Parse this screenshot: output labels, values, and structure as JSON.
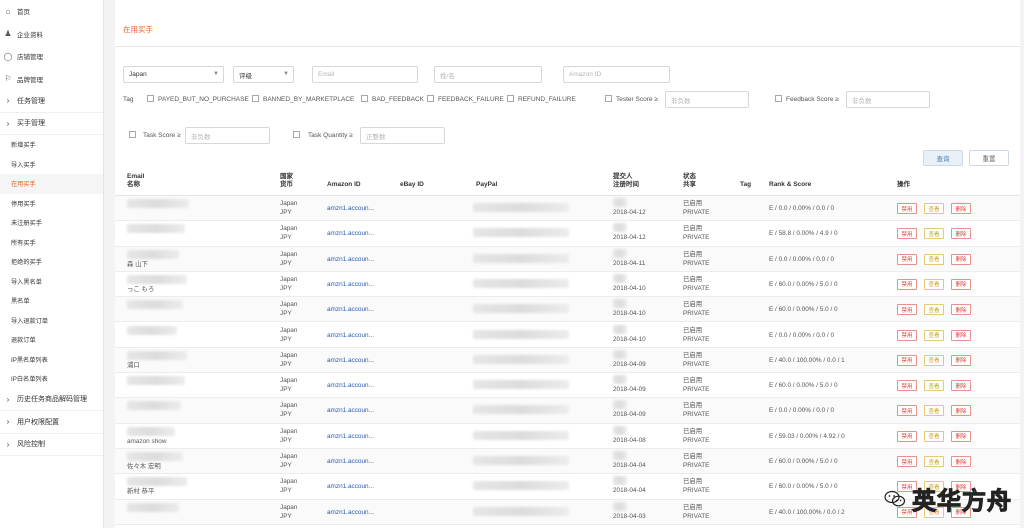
{
  "sidebar": {
    "top_items": [
      {
        "icon": "home-icon",
        "glyph": "⌂",
        "label": "首页"
      },
      {
        "icon": "company-icon",
        "glyph": "♟",
        "label": "企业资料"
      },
      {
        "icon": "shop-icon",
        "glyph": "◯",
        "label": "店铺管理"
      },
      {
        "icon": "bookmark-icon",
        "glyph": "⚐",
        "label": "品牌管理"
      }
    ],
    "groups_before": [
      {
        "label": "任务管理"
      },
      {
        "label": "买手管理"
      }
    ],
    "sub_items": [
      {
        "label": "新增买手",
        "active": false
      },
      {
        "label": "导入买手",
        "active": false
      },
      {
        "label": "在用买手",
        "active": true
      },
      {
        "label": "停用买手",
        "active": false
      },
      {
        "label": "未注册买手",
        "active": false
      },
      {
        "label": "所有买手",
        "active": false
      },
      {
        "label": "拒绝的买手",
        "active": false
      },
      {
        "label": "导入黑名单",
        "active": false
      },
      {
        "label": "黑名单",
        "active": false
      },
      {
        "label": "导入退款订单",
        "active": false
      },
      {
        "label": "退款订单",
        "active": false
      },
      {
        "label": "IP黑名单列表",
        "active": false
      },
      {
        "label": "IP白名单列表",
        "active": false
      }
    ],
    "groups_after": [
      {
        "label": "历史任务商品解码管理"
      },
      {
        "label": "用户权限配置"
      },
      {
        "label": "风险控制"
      }
    ]
  },
  "page": {
    "title": "在用买手"
  },
  "filters": {
    "country": "Japan",
    "rating": "评级",
    "email_placeholder": "Email",
    "name_placeholder": "姓/名",
    "amazon_id_placeholder": "Amazon ID",
    "tag_label": "Tag",
    "tags": [
      "PAYED_BUT_NO_PURCHASE",
      "BANNED_BY_MARKETPLACE",
      "BAD_FEEDBACK",
      "FEEDBACK_FAILURE",
      "REFUND_FAILURE"
    ],
    "tester_score_label": "Tester Score ≥",
    "tester_score_placeholder": "非负数",
    "feedback_score_label": "Feedback Score ≥",
    "feedback_score_placeholder": "非负数",
    "task_score_label": "Task Score ≥",
    "task_score_placeholder": "非负数",
    "task_quantity_label": "Task Quantity ≥",
    "task_quantity_placeholder": "正整数",
    "search_label": "查询",
    "reset_label": "重置"
  },
  "table": {
    "headers": {
      "email": "Email",
      "name": "名称",
      "country": "国家",
      "currency": "货币",
      "amazon_id": "Amazon ID",
      "ebay_id": "eBay ID",
      "paypal": "PayPal",
      "submitter": "提交人",
      "reg_time": "注册时间",
      "status": "状态",
      "share": "共享",
      "tag": "Tag",
      "rank_score": "Rank & Score",
      "actions": "操作"
    },
    "action_labels": {
      "ban": "禁用",
      "view": "查看",
      "delete": "删除"
    },
    "rows": [
      {
        "name": "",
        "country": "Japan",
        "currency": "JPY",
        "amazon": "amzn1.accoun...",
        "date": "2018-04-12",
        "status": "已启用",
        "share": "PRIVATE",
        "rank": "E / 0.0 / 0.00% / 0.0 / 0"
      },
      {
        "name": "",
        "country": "Japan",
        "currency": "JPY",
        "amazon": "amzn1.accoun...",
        "date": "2018-04-12",
        "status": "已启用",
        "share": "PRIVATE",
        "rank": "E / 58.8 / 0.00% / 4.9 / 0"
      },
      {
        "name": "森 山下",
        "country": "Japan",
        "currency": "JPY",
        "amazon": "amzn1.accoun...",
        "date": "2018-04-11",
        "status": "已启用",
        "share": "PRIVATE",
        "rank": "E / 0.0 / 0.00% / 0.0 / 0"
      },
      {
        "name": "っこ もろ",
        "country": "Japan",
        "currency": "JPY",
        "amazon": "amzn1.accoun...",
        "date": "2018-04-10",
        "status": "已启用",
        "share": "PRIVATE",
        "rank": "E / 60.0 / 0.00% / 5.0 / 0"
      },
      {
        "name": "",
        "country": "Japan",
        "currency": "JPY",
        "amazon": "amzn1.accoun...",
        "date": "2018-04-10",
        "status": "已启用",
        "share": "PRIVATE",
        "rank": "E / 60.0 / 0.00% / 5.0 / 0"
      },
      {
        "name": "",
        "country": "Japan",
        "currency": "JPY",
        "amazon": "amzn1.accoun...",
        "date": "2018-04-10",
        "status": "已启用",
        "share": "PRIVATE",
        "rank": "E / 0.0 / 0.00% / 0.0 / 0"
      },
      {
        "name": "浦口",
        "country": "Japan",
        "currency": "JPY",
        "amazon": "amzn1.accoun...",
        "date": "2018-04-09",
        "status": "已启用",
        "share": "PRIVATE",
        "rank": "E / 40.0 / 100.00% / 0.0 / 1"
      },
      {
        "name": "",
        "country": "Japan",
        "currency": "JPY",
        "amazon": "amzn1.accoun...",
        "date": "2018-04-09",
        "status": "已启用",
        "share": "PRIVATE",
        "rank": "E / 60.0 / 0.00% / 5.0 / 0"
      },
      {
        "name": "",
        "country": "Japan",
        "currency": "JPY",
        "amazon": "amzn1.accoun...",
        "date": "2018-04-09",
        "status": "已启用",
        "share": "PRIVATE",
        "rank": "E / 0.0 / 0.00% / 0.0 / 0"
      },
      {
        "name": "amazon show",
        "country": "Japan",
        "currency": "JPY",
        "amazon": "amzn1.accoun...",
        "date": "2018-04-08",
        "status": "已启用",
        "share": "PRIVATE",
        "rank": "E / 59.03 / 0.00% / 4.92 / 0"
      },
      {
        "name": "佐々木 宏明",
        "country": "Japan",
        "currency": "JPY",
        "amazon": "amzn1.accoun...",
        "date": "2018-04-04",
        "status": "已启用",
        "share": "PRIVATE",
        "rank": "E / 60.0 / 0.00% / 5.0 / 0"
      },
      {
        "name": "新村 恭平",
        "country": "Japan",
        "currency": "JPY",
        "amazon": "amzn1.accoun...",
        "date": "2018-04-04",
        "status": "已启用",
        "share": "PRIVATE",
        "rank": "E / 60.0 / 0.00% / 5.0 / 0"
      },
      {
        "name": "",
        "country": "Japan",
        "currency": "JPY",
        "amazon": "amzn1.accoun...",
        "date": "2018-04-03",
        "status": "已启用",
        "share": "PRIVATE",
        "rank": "E / 40.0 / 100.00% / 0.0 / 2"
      }
    ]
  },
  "watermark": {
    "text": "英华方舟"
  },
  "colors": {
    "accent": "#e8602c",
    "link": "#2a5bb0",
    "danger": "#d9453b",
    "warn": "#c9a022"
  }
}
